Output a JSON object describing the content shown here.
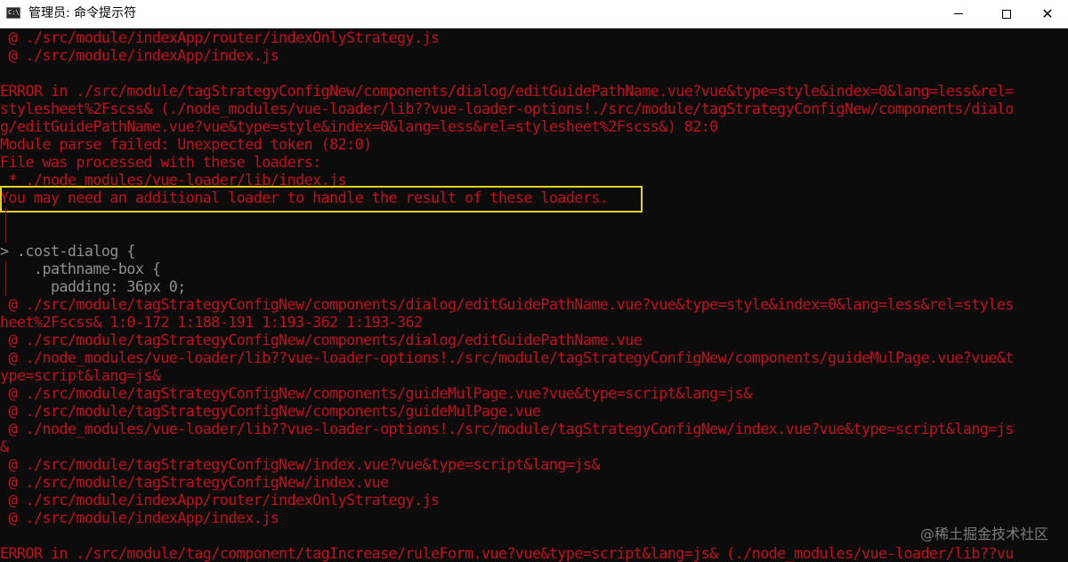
{
  "window": {
    "title": "管理员: 命令提示符",
    "app_icon": "cmd-icon",
    "app_icon_text": "C:\\",
    "controls": [
      "minimize-icon",
      "maximize-icon",
      "close-icon"
    ],
    "close_glyph": "✕"
  },
  "colors": {
    "background": "#0c0c0c",
    "error_text": "#c50f1f",
    "code_text": "#8f8f8f",
    "highlight_border": "#e2d21f"
  },
  "console": {
    "lines": [
      " @ ./src/module/indexApp/router/indexOnlyStrategy.js",
      " @ ./src/module/indexApp/index.js",
      "",
      "ERROR in ./src/module/tagStrategyConfigNew/components/dialog/editGuidePathName.vue?vue&type=style&index=0&lang=less&rel=",
      "stylesheet%2Fscss& (./node_modules/vue-loader/lib??vue-loader-options!./src/module/tagStrategyConfigNew/components/dialo",
      "g/editGuidePathName.vue?vue&type=style&index=0&lang=less&rel=stylesheet%2Fscss&) 82:0",
      "Module parse failed: Unexpected token (82:0)",
      "File was processed with these loaders:",
      " * ./node_modules/vue-loader/lib/index.js",
      "You may need an additional loader to handle the result of these loaders.",
      "",
      "",
      "> .cost-dialog {",
      "    .pathname-box {",
      "      padding: 36px 0;",
      " @ ./src/module/tagStrategyConfigNew/components/dialog/editGuidePathName.vue?vue&type=style&index=0&lang=less&rel=styles",
      "heet%2Fscss& 1:0-172 1:188-191 1:193-362 1:193-362",
      " @ ./src/module/tagStrategyConfigNew/components/dialog/editGuidePathName.vue",
      " @ ./node_modules/vue-loader/lib??vue-loader-options!./src/module/tagStrategyConfigNew/components/guideMulPage.vue?vue&t",
      "ype=script&lang=js&",
      " @ ./src/module/tagStrategyConfigNew/components/guideMulPage.vue?vue&type=script&lang=js&",
      " @ ./src/module/tagStrategyConfigNew/components/guideMulPage.vue",
      " @ ./node_modules/vue-loader/lib??vue-loader-options!./src/module/tagStrategyConfigNew/index.vue?vue&type=script&lang=js",
      "&",
      " @ ./src/module/tagStrategyConfigNew/index.vue?vue&type=script&lang=js&",
      " @ ./src/module/tagStrategyConfigNew/index.vue",
      " @ ./src/module/indexApp/router/indexOnlyStrategy.js",
      " @ ./src/module/indexApp/index.js",
      "",
      "ERROR in ./src/module/tag/component/tagIncrease/ruleForm.vue?vue&type=script&lang=js& (./node_modules/vue-loader/lib??vu"
    ]
  },
  "watermark": "@稀土掘金技术社区"
}
